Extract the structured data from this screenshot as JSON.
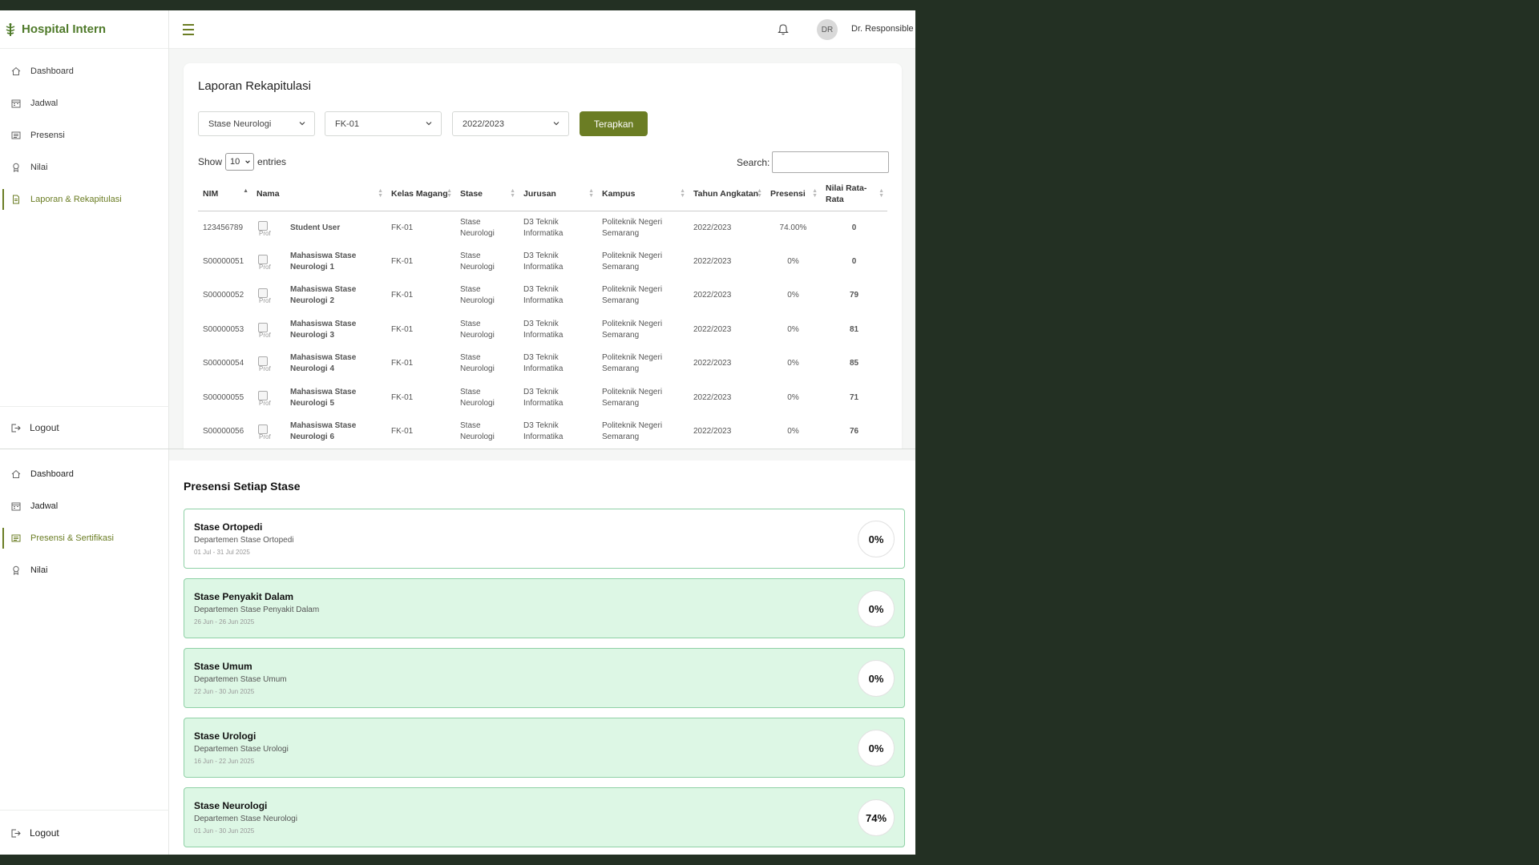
{
  "app": {
    "brand": "Hospital Intern"
  },
  "sidebar_top": {
    "items": [
      {
        "label": "Dashboard",
        "icon": "home-icon"
      },
      {
        "label": "Jadwal",
        "icon": "calendar-icon"
      },
      {
        "label": "Presensi",
        "icon": "list-icon"
      },
      {
        "label": "Nilai",
        "icon": "award-icon"
      },
      {
        "label": "Laporan & Rekapitulasi",
        "icon": "document-icon",
        "active": true
      }
    ],
    "logout": "Logout"
  },
  "header": {
    "user_initials": "DR",
    "user_name": "Dr. Responsible"
  },
  "report": {
    "title": "Laporan Rekapitulasi",
    "filters": {
      "stase": "Stase Neurologi",
      "kelas": "FK-01",
      "tahun": "2022/2023"
    },
    "apply_label": "Terapkan",
    "show_label": "Show",
    "show_value": "10",
    "entries_label": "entries",
    "search_label": "Search:",
    "search_value": "",
    "columns": [
      "NIM",
      "Nama",
      "Kelas Magang",
      "Stase",
      "Jurusan",
      "Kampus",
      "Tahun Angkatan",
      "Presensi",
      "Nilai Rata-Rata"
    ],
    "rows": [
      {
        "nim": "123456789",
        "nama": "Student User",
        "kelas": "FK-01",
        "stase": "Stase Neurologi",
        "jurusan": "D3 Teknik Informatika",
        "kampus": "Politeknik Negeri Semarang",
        "tahun": "2022/2023",
        "presensi": "74.00%",
        "nilai": "0"
      },
      {
        "nim": "S00000051",
        "nama": "Mahasiswa Stase Neurologi 1",
        "kelas": "FK-01",
        "stase": "Stase Neurologi",
        "jurusan": "D3 Teknik Informatika",
        "kampus": "Politeknik Negeri Semarang",
        "tahun": "2022/2023",
        "presensi": "0%",
        "nilai": "0"
      },
      {
        "nim": "S00000052",
        "nama": "Mahasiswa Stase Neurologi 2",
        "kelas": "FK-01",
        "stase": "Stase Neurologi",
        "jurusan": "D3 Teknik Informatika",
        "kampus": "Politeknik Negeri Semarang",
        "tahun": "2022/2023",
        "presensi": "0%",
        "nilai": "79"
      },
      {
        "nim": "S00000053",
        "nama": "Mahasiswa Stase Neurologi 3",
        "kelas": "FK-01",
        "stase": "Stase Neurologi",
        "jurusan": "D3 Teknik Informatika",
        "kampus": "Politeknik Negeri Semarang",
        "tahun": "2022/2023",
        "presensi": "0%",
        "nilai": "81"
      },
      {
        "nim": "S00000054",
        "nama": "Mahasiswa Stase Neurologi 4",
        "kelas": "FK-01",
        "stase": "Stase Neurologi",
        "jurusan": "D3 Teknik Informatika",
        "kampus": "Politeknik Negeri Semarang",
        "tahun": "2022/2023",
        "presensi": "0%",
        "nilai": "85"
      },
      {
        "nim": "S00000055",
        "nama": "Mahasiswa Stase Neurologi 5",
        "kelas": "FK-01",
        "stase": "Stase Neurologi",
        "jurusan": "D3 Teknik Informatika",
        "kampus": "Politeknik Negeri Semarang",
        "tahun": "2022/2023",
        "presensi": "0%",
        "nilai": "71"
      },
      {
        "nim": "S00000056",
        "nama": "Mahasiswa Stase Neurologi 6",
        "kelas": "FK-01",
        "stase": "Stase Neurologi",
        "jurusan": "D3 Teknik Informatika",
        "kampus": "Politeknik Negeri Semarang",
        "tahun": "2022/2023",
        "presensi": "0%",
        "nilai": "76"
      }
    ]
  },
  "sidebar_bottom": {
    "items": [
      {
        "label": "Dashboard",
        "icon": "home-icon"
      },
      {
        "label": "Jadwal",
        "icon": "calendar-icon"
      },
      {
        "label": "Presensi & Sertifikasi",
        "icon": "list-icon",
        "active": true
      },
      {
        "label": "Nilai",
        "icon": "award-icon"
      }
    ],
    "logout": "Logout"
  },
  "presensi": {
    "title": "Presensi Setiap Stase",
    "items": [
      {
        "name": "Stase Ortopedi",
        "dept": "Departemen Stase Ortopedi",
        "date": "01 Jul - 31 Jul 2025",
        "percent": "0%"
      },
      {
        "name": "Stase Penyakit Dalam",
        "dept": "Departemen Stase Penyakit Dalam",
        "date": "26 Jun - 26 Jun 2025",
        "percent": "0%"
      },
      {
        "name": "Stase Umum",
        "dept": "Departemen Stase Umum",
        "date": "22 Jun - 30 Jun 2025",
        "percent": "0%"
      },
      {
        "name": "Stase Urologi",
        "dept": "Departemen Stase Urologi",
        "date": "16 Jun - 22 Jun 2025",
        "percent": "0%"
      },
      {
        "name": "Stase Neurologi",
        "dept": "Departemen Stase Neurologi",
        "date": "01 Jun - 30 Jun 2025",
        "percent": "74%"
      }
    ]
  },
  "colors": {
    "accent": "#6b7d24",
    "brand": "#4f7a2a",
    "presensi_text": "#b5482b",
    "card_green": "#ddf7e5",
    "card_border": "#8fd1a6",
    "backdrop": "#233023"
  }
}
